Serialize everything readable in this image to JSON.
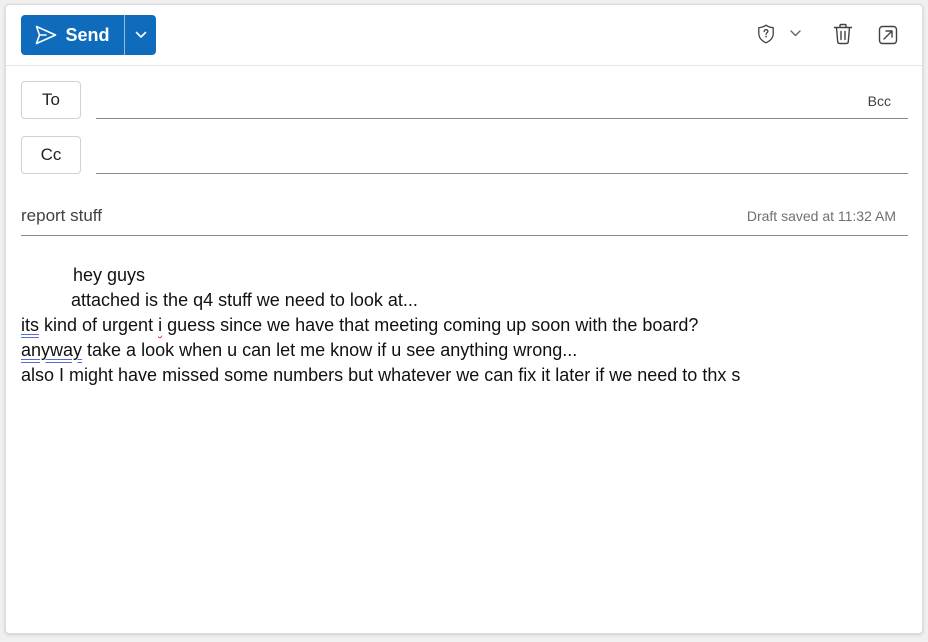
{
  "toolbar": {
    "send_label": "Send",
    "icons": [
      "send-icon",
      "chevron-down-icon",
      "sensitivity-shield-icon",
      "chevron-down-icon",
      "trash-icon",
      "pop-out-icon"
    ]
  },
  "recipients": {
    "to_label": "To",
    "to_value": "",
    "bcc_label": "Bcc",
    "cc_label": "Cc",
    "cc_value": ""
  },
  "subject": {
    "value": "report stuff",
    "draft_status": "Draft saved at 11:32 AM"
  },
  "body": {
    "line1": "hey guys",
    "line2": "attached is the q4 stuff we need to look at...",
    "line3_word1": "its",
    "line3_mid": " kind of urgent ",
    "line3_word2": "i",
    "line3_rest": " guess since we have that meeting coming up soon with the board?",
    "line4_word1": "anyway",
    "line4_rest": " take a look when u can let me know if u see anything wrong...",
    "line5": "also I might have missed some numbers but whatever we can fix it later if we need to thx s"
  },
  "colors": {
    "accent": "#0f6cbd",
    "spellcheck_grammar": "#5b6bd6",
    "spellcheck_spelling": "#d13438"
  }
}
